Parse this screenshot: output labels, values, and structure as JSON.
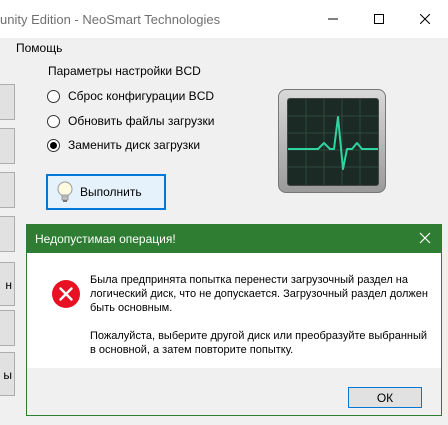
{
  "window": {
    "title": "unity Edition - NeoSmart Technologies",
    "menu_help": "Помощь"
  },
  "left_buttons": [
    {
      "label": ""
    },
    {
      "label": ""
    },
    {
      "label": ""
    },
    {
      "label": ""
    },
    {
      "label": "н"
    },
    {
      "label": ""
    },
    {
      "label": "ы"
    }
  ],
  "bcd": {
    "group_title": "Параметры настройки BCD",
    "options": [
      {
        "label": "Сброс конфигурации BCD",
        "checked": false
      },
      {
        "label": "Обновить файлы загрузки",
        "checked": false
      },
      {
        "label": "Заменить диск загрузки",
        "checked": true
      }
    ],
    "run_label": "Выполнить"
  },
  "dialog": {
    "title": "Недопустимая операция!",
    "message1": "Была предпринята попытка перенести загрузочный раздел на логический диск, что не допускается. Загрузочный раздел должен быть основным.",
    "message2": "Пожалуйста, выберите другой диск или преобразуйте выбранный в основной, а затем повторите попытку.",
    "ok_label": "ОК",
    "icon": "error-icon"
  },
  "colors": {
    "dialog_accent": "#2f7d32",
    "focus_blue": "#0078d7",
    "error_red": "#e81123",
    "monitor_line": "#2fd3a0"
  }
}
